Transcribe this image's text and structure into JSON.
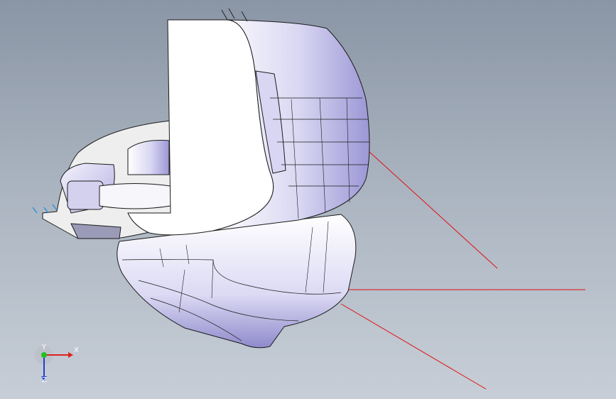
{
  "viewport": {
    "background_top": "#8a95a5",
    "background_bottom": "#c7ced7"
  },
  "model": {
    "face_color": "#ffffff",
    "shade_color": "#aca7df",
    "edge_color": "#1a1a1a",
    "sketch_line_color": "#e01010"
  },
  "triad": {
    "x_label": "X",
    "y_label": "Y",
    "z_label": "Z",
    "x_color": "#e02020",
    "y_color": "#20c020",
    "z_color": "#2040d0"
  }
}
